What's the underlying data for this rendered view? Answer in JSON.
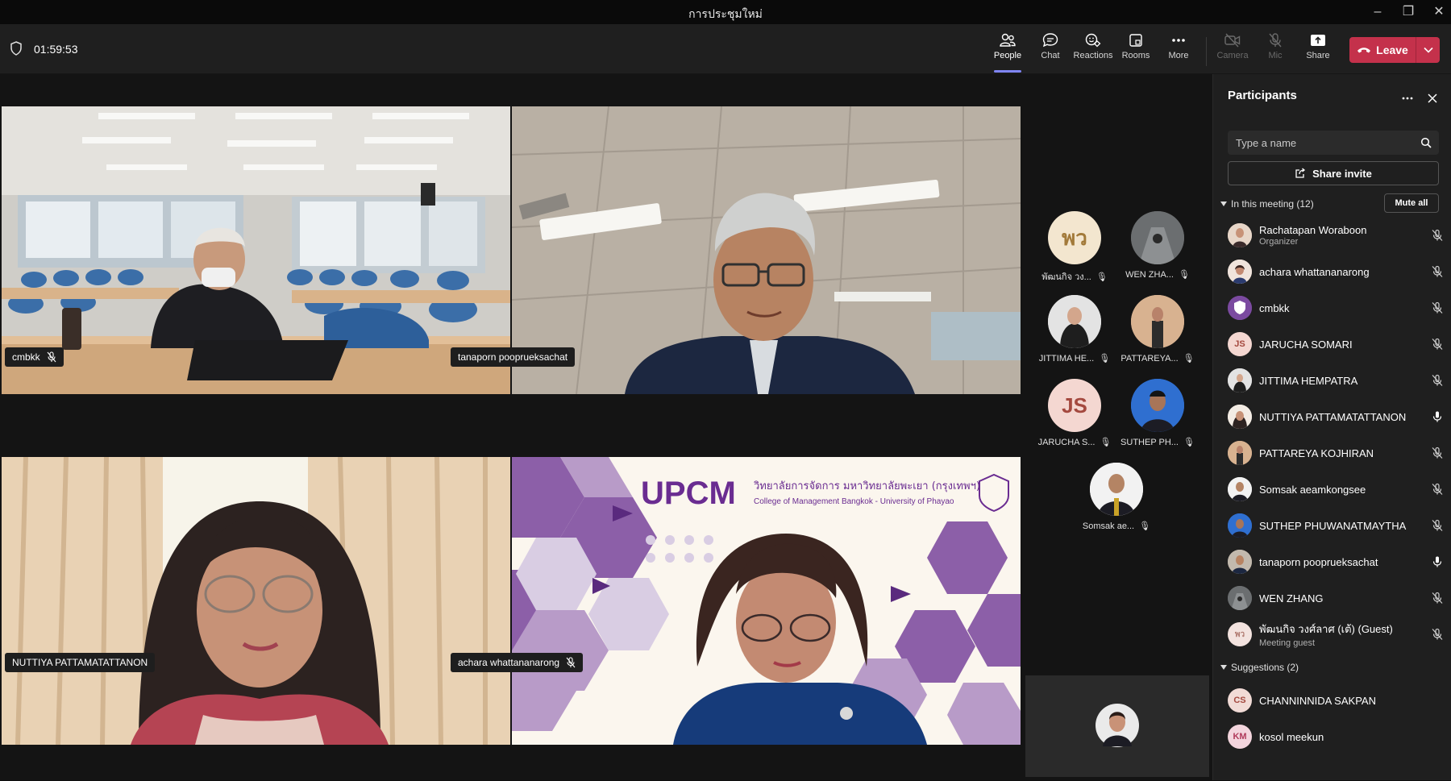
{
  "window": {
    "title": "การประชุมใหม่",
    "minimize": "–",
    "restore": "❐",
    "close": "✕"
  },
  "toolbar": {
    "timer": "01:59:53",
    "people": "People",
    "chat": "Chat",
    "reactions": "Reactions",
    "rooms": "Rooms",
    "more": "More",
    "camera": "Camera",
    "mic": "Mic",
    "share": "Share",
    "leave": "Leave"
  },
  "stage": {
    "tiles": [
      {
        "name": "cmbkk",
        "muted": true
      },
      {
        "name": "tanaporn pooprueksachat",
        "muted": false
      },
      {
        "name": "NUTTIYA PATTAMATATTANON",
        "muted": false
      },
      {
        "name": "achara whattananarong",
        "muted": true
      }
    ],
    "upcm_logo": "UPCM",
    "upcm_thai": "วิทยาลัยการจัดการ มหาวิทยาลัยพะเยา (กรุงเทพฯ)",
    "upcm_en": "College of Management Bangkok - University of Phayao"
  },
  "strip": {
    "avatars": [
      {
        "label": "พัฒนกิจ วง...",
        "initials": "พว"
      },
      {
        "label": "WEN ZHA..."
      },
      {
        "label": "JITTIMA HE..."
      },
      {
        "label": "PATTAREYA..."
      },
      {
        "label": "JARUCHA S...",
        "initials": "JS"
      },
      {
        "label": "SUTHEP PH..."
      },
      {
        "label": "Somsak ae..."
      }
    ]
  },
  "panel": {
    "title": "Participants",
    "search_placeholder": "Type a name",
    "share_invite": "Share invite",
    "in_meeting": "In this meeting (12)",
    "mute_all": "Mute all",
    "suggestions": "Suggestions (2)",
    "participants": [
      {
        "name": "Rachatapan Woraboon",
        "role": "Organizer",
        "mic": "muted"
      },
      {
        "name": "achara whattananarong",
        "mic": "muted"
      },
      {
        "name": "cmbkk",
        "mic": "muted"
      },
      {
        "name": "JARUCHA SOMARI",
        "initials": "JS",
        "mic": "muted"
      },
      {
        "name": "JITTIMA HEMPATRA",
        "mic": "muted"
      },
      {
        "name": "NUTTIYA PATTAMATATTANON",
        "mic": "on"
      },
      {
        "name": "PATTAREYA KOJHIRAN",
        "mic": "muted"
      },
      {
        "name": "Somsak aeamkongsee",
        "mic": "muted"
      },
      {
        "name": "SUTHEP PHUWANATMAYTHA",
        "mic": "muted"
      },
      {
        "name": "tanaporn pooprueksachat",
        "mic": "on"
      },
      {
        "name": "WEN ZHANG",
        "mic": "muted"
      },
      {
        "name": "พัฒนกิจ วงศ์ลาศ (เต้) (Guest)",
        "role": "Meeting guest",
        "initials": "พว",
        "mic": "muted"
      }
    ],
    "suggested": [
      {
        "name": "CHANNINNIDA SAKPAN",
        "initials": "CS"
      },
      {
        "name": "kosol meekun",
        "initials": "KM"
      }
    ]
  },
  "colors": {
    "accent": "#7f85f5",
    "leave": "#c4314b",
    "purple": "#6a2c91"
  }
}
